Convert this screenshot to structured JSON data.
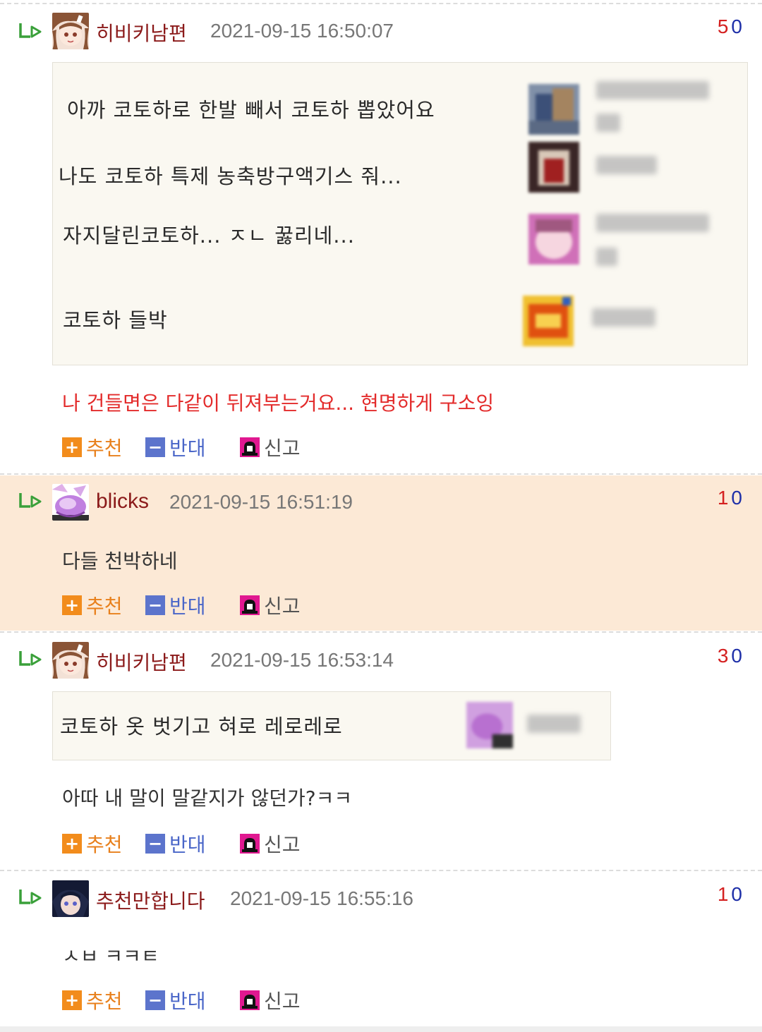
{
  "actions": {
    "upvote": "추천",
    "downvote": "반대",
    "report": "신고"
  },
  "comments": [
    {
      "nickname": "히비키남편",
      "date": "2021-09-15 16:50:07",
      "score_up": "5",
      "score_down": "0",
      "quoted": [
        "아까 코토하로 한발 빼서 코토하 뽑았어요",
        "나도 코토하 특제 농축방구액기스 줘...",
        "자지달린코토하... ㅈㄴ 꿇리네...",
        "코토하 들박"
      ],
      "text": "나 건들면은 다같이 뒤져부는거요... 현명하게 구소잉"
    },
    {
      "nickname": "blicks",
      "date": "2021-09-15 16:51:19",
      "score_up": "1",
      "score_down": "0",
      "text": "다들 천박하네"
    },
    {
      "nickname": "히비키남편",
      "date": "2021-09-15 16:53:14",
      "score_up": "3",
      "score_down": "0",
      "quoted": [
        "코토하 옷 벗기고 혀로 레로레로"
      ],
      "text": "아따 내 말이 말같지가 않던가?ㅋㅋ"
    },
    {
      "nickname": "추천만합니다",
      "date": "2021-09-15 16:55:16",
      "score_up": "1",
      "score_down": "0",
      "text": "ㅅㅂ ㅋㅋㅌ"
    }
  ],
  "icons": {
    "reply": "reply-arrow-icon",
    "upvote": "plus-icon",
    "downvote": "minus-icon",
    "report": "siren-icon"
  },
  "colors": {
    "nickname": "#8b1a1a",
    "score_up": "#d42020",
    "score_down": "#1e2fa8",
    "highlight_bg": "#fce9d6",
    "red_text": "#e32b2b",
    "upvote": "#f28c1c",
    "downvote": "#5c74cc"
  }
}
